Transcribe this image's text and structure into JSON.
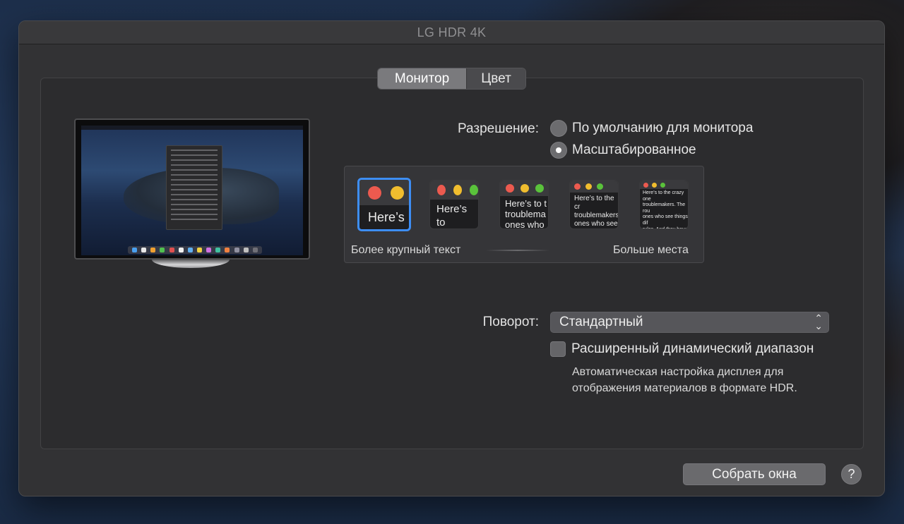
{
  "window": {
    "title": "LG HDR 4K"
  },
  "tabs": [
    {
      "label": "Монитор",
      "active": true
    },
    {
      "label": "Цвет",
      "active": false
    }
  ],
  "resolution": {
    "label": "Разрешение:",
    "options": [
      {
        "label": "По умолчанию для монитора",
        "checked": false
      },
      {
        "label": "Масштабированное",
        "checked": true
      }
    ]
  },
  "scaling": {
    "thumbnails": [
      {
        "text": "Here’s",
        "selected": true
      },
      {
        "text": "Here’s to\ntroublem",
        "selected": false
      },
      {
        "text": "Here’s to t\ntroublema\nones who",
        "selected": false
      },
      {
        "text": "Here’s to the cr\ntroublemakers.\nones who see t\nrules. And they",
        "selected": false
      },
      {
        "text": "Here’s to the crazy one\ntroublemakers. The rou\nones who see things dif\nrules. And they have no\ncan quote them, disagre\nthem. About the only th\nBecause they change th",
        "selected": false
      }
    ],
    "larger_text_label": "Более крупный текст",
    "more_space_label": "Больше места"
  },
  "rotation": {
    "label": "Поворот:",
    "value": "Стандартный"
  },
  "hdr": {
    "label": "Расширенный динамический диапазон",
    "checked": false,
    "description_lines": [
      "Автоматическая настройка дисплея для",
      "отображения материалов в формате HDR."
    ]
  },
  "buttons": {
    "gather": "Собрать окна",
    "help": "?"
  },
  "colors": {
    "accent": "#3d8ef5",
    "traffic_red": "#ec5a4f",
    "traffic_yellow": "#f0bd2e",
    "traffic_green": "#5ac23b"
  }
}
